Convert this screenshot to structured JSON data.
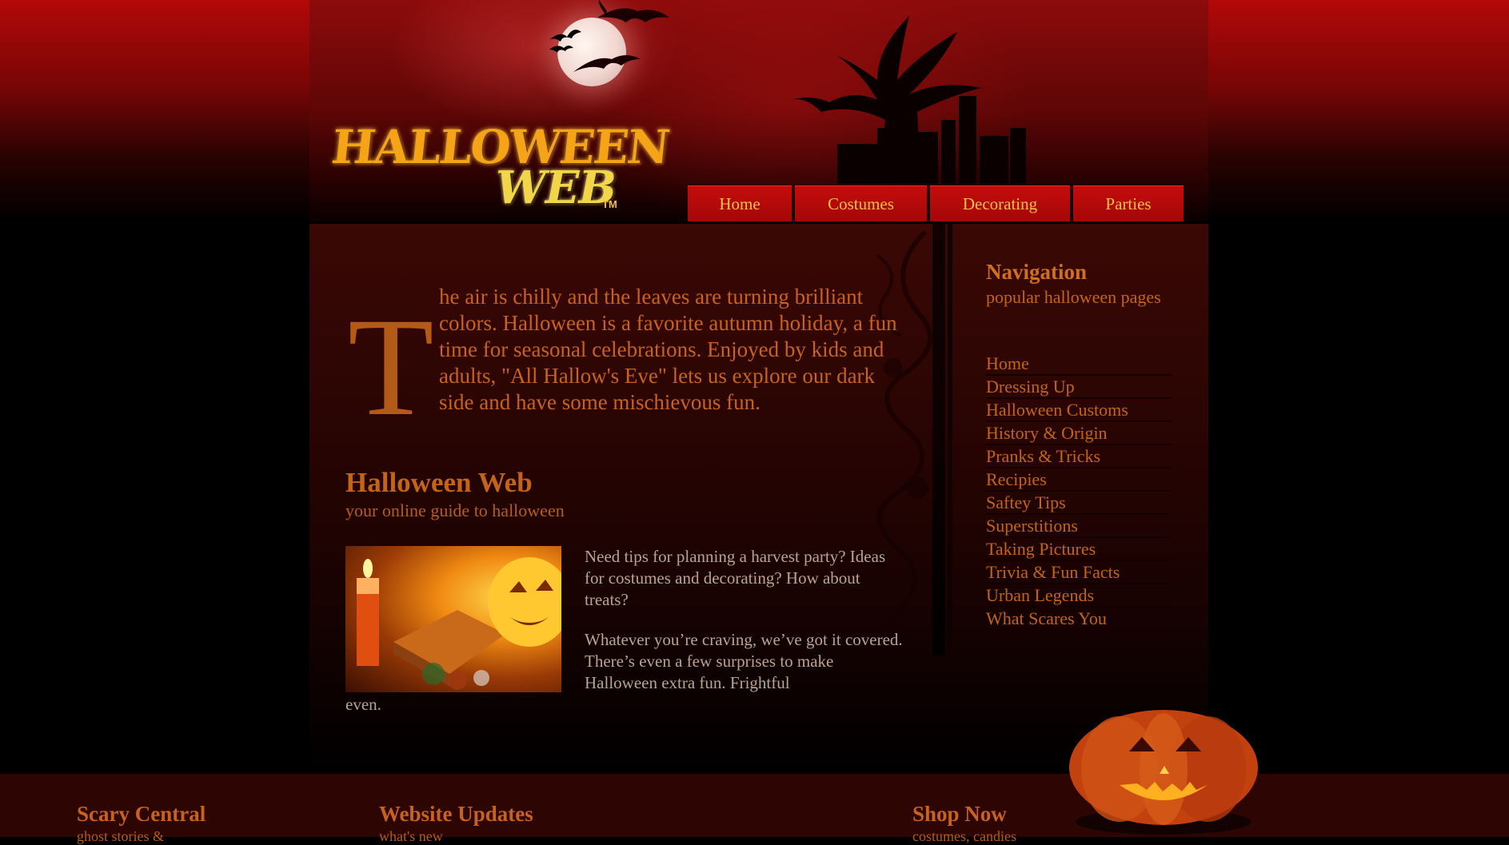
{
  "header": {
    "logo_line1": "HALLOWEEN",
    "logo_line2": "WEB",
    "logo_tm": "TM"
  },
  "tabs": [
    {
      "label": "Home"
    },
    {
      "label": "Costumes"
    },
    {
      "label": "Decorating"
    },
    {
      "label": "Parties"
    }
  ],
  "main": {
    "dropcap": "T",
    "intro": "he air is chilly and the leaves are turning brilliant colors. Halloween is a favorite autumn holiday, a fun time for seasonal celebrations. Enjoyed by kids and adults, \"All Hallow's Eve\" lets us explore our dark side and have some mischievous fun.",
    "site_title": "Halloween Web",
    "site_tagline": "your online guide to halloween",
    "body_p1": "Need tips for planning a harvest party? Ideas for costumes and decorating? How about treats?",
    "body_p2": "Whatever you’re craving, we’ve got it covered. There’s even a few surprises to make Halloween extra fun. Frightful",
    "body_tail": "even."
  },
  "sidebar": {
    "heading": "Navigation",
    "subheading": "popular halloween pages",
    "items": [
      {
        "label": "Home"
      },
      {
        "label": "Dressing Up"
      },
      {
        "label": "Halloween Customs"
      },
      {
        "label": "History & Origin"
      },
      {
        "label": "Pranks & Tricks"
      },
      {
        "label": "Recipies"
      },
      {
        "label": "Saftey Tips"
      },
      {
        "label": "Superstitions"
      },
      {
        "label": "Taking Pictures"
      },
      {
        "label": "Trivia & Fun Facts"
      },
      {
        "label": "Urban Legends"
      },
      {
        "label": "What Scares You"
      }
    ]
  },
  "footer": {
    "col1_heading": "Scary Central",
    "col1_sub": "ghost stories &",
    "col2_heading": "Website Updates",
    "col2_sub": "what's new",
    "col3_heading": "Shop Now",
    "col3_sub": "costumes, candies"
  },
  "colors": {
    "accent_orange": "#c46418",
    "tab_red": "#c40c0c",
    "tab_text": "#f6c14a",
    "body_text": "#b9a490"
  }
}
